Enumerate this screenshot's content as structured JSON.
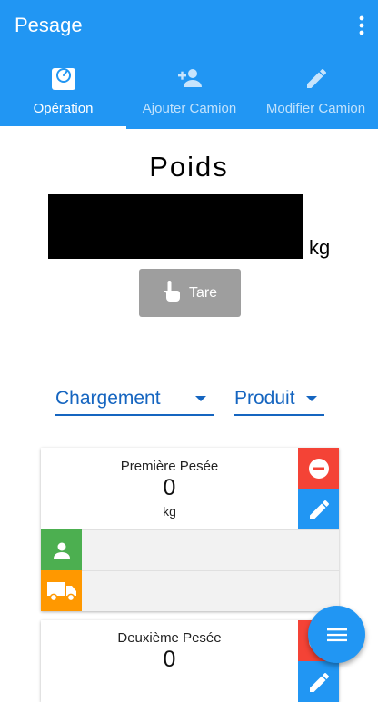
{
  "app": {
    "title": "Pesage"
  },
  "tabs": [
    {
      "label": "Opération",
      "icon": "scale-icon",
      "active": true
    },
    {
      "label": "Ajouter Camion",
      "icon": "person-add-icon",
      "active": false
    },
    {
      "label": "Modifier Camion",
      "icon": "pencil-icon",
      "active": false
    }
  ],
  "weight": {
    "title": "Poids",
    "unit": "kg"
  },
  "tare": {
    "label": "Tare",
    "icon": "touch-icon"
  },
  "selectors": {
    "operation": "Chargement",
    "product": "Produit"
  },
  "cards": [
    {
      "title": "Première Pesée",
      "value": "0",
      "unit": "kg"
    },
    {
      "title": "Deuxième Pesée",
      "value": "0"
    }
  ],
  "colors": {
    "primary": "#2196F3",
    "remove": "#F44336",
    "person": "#4CAF50",
    "truck": "#FF9800",
    "dropdown": "#1565C0"
  }
}
